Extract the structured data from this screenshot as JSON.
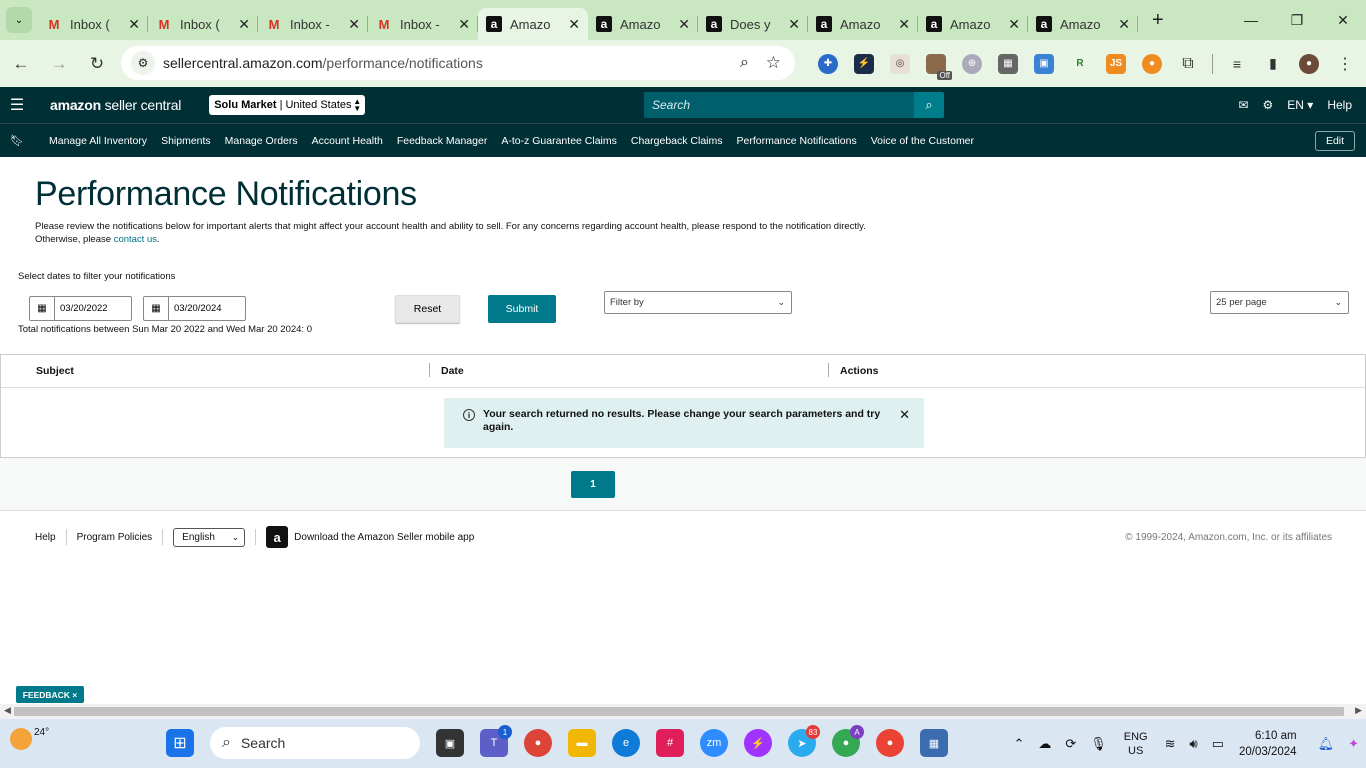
{
  "browser": {
    "tabs": [
      {
        "title": "Inbox (",
        "icon": "gmail-icon",
        "active": false
      },
      {
        "title": "Inbox (",
        "icon": "gmail-icon",
        "active": false
      },
      {
        "title": "Inbox -",
        "icon": "gmail-icon",
        "active": false
      },
      {
        "title": "Inbox -",
        "icon": "gmail-icon",
        "active": false
      },
      {
        "title": "Amazo",
        "icon": "amazon-icon",
        "active": true
      },
      {
        "title": "Amazo",
        "icon": "amazon-icon",
        "active": false
      },
      {
        "title": "Does y",
        "icon": "amazon-icon",
        "active": false
      },
      {
        "title": "Amazo",
        "icon": "amazon-icon",
        "active": false
      },
      {
        "title": "Amazo",
        "icon": "amazon-icon",
        "active": false
      },
      {
        "title": "Amazo",
        "icon": "amazon-icon",
        "active": false
      }
    ],
    "url_host": "sellercentral.amazon.com",
    "url_path": "/performance/notifications",
    "extension_badge": "Off"
  },
  "header": {
    "logo_bold": "amazon",
    "logo_rest": " seller central",
    "store_name": "Solu Market",
    "store_region": "| United States",
    "search_placeholder": "Search",
    "language": "EN",
    "help": "Help"
  },
  "nav": {
    "items": [
      "Manage All Inventory",
      "Shipments",
      "Manage Orders",
      "Account Health",
      "Feedback Manager",
      "A-to-z Guarantee Claims",
      "Chargeback Claims",
      "Performance Notifications",
      "Voice of the Customer"
    ],
    "edit": "Edit"
  },
  "page": {
    "title": "Performance Notifications",
    "description": "Please review the notifications below for important alerts that might affect your account health and ability to sell. For any concerns regarding account health, please respond to the notification directly.",
    "description_line2": "Otherwise, please ",
    "contact_link": "contact us",
    "contact_after": ".",
    "filter_label": "Select dates to filter your notifications",
    "date_from": "03/20/2022",
    "date_to": "03/20/2024",
    "total_text": "Total notifications between Sun Mar 20 2022 and Wed Mar 20 2024: 0",
    "reset": "Reset",
    "submit": "Submit",
    "filter_by": "Filter by",
    "per_page": "25 per page",
    "columns": [
      "Subject",
      "Date",
      "Actions"
    ],
    "no_results": "Your search returned no results. Please change your search parameters and try again.",
    "current_page": "1"
  },
  "footer": {
    "help": "Help",
    "policies": "Program Policies",
    "language": "English",
    "app_link": "Download the Amazon Seller mobile app",
    "copyright": "© 1999-2024, Amazon.com, Inc. or its affiliates",
    "feedback": "FEEDBACK ×"
  },
  "taskbar": {
    "temperature": "24°",
    "search": "Search",
    "teams_badge": "1",
    "telegram_badge": "83",
    "chrome_badge": "A",
    "lang_top": "ENG",
    "lang_bottom": "US",
    "time": "6:10 am",
    "date": "20/03/2024"
  }
}
